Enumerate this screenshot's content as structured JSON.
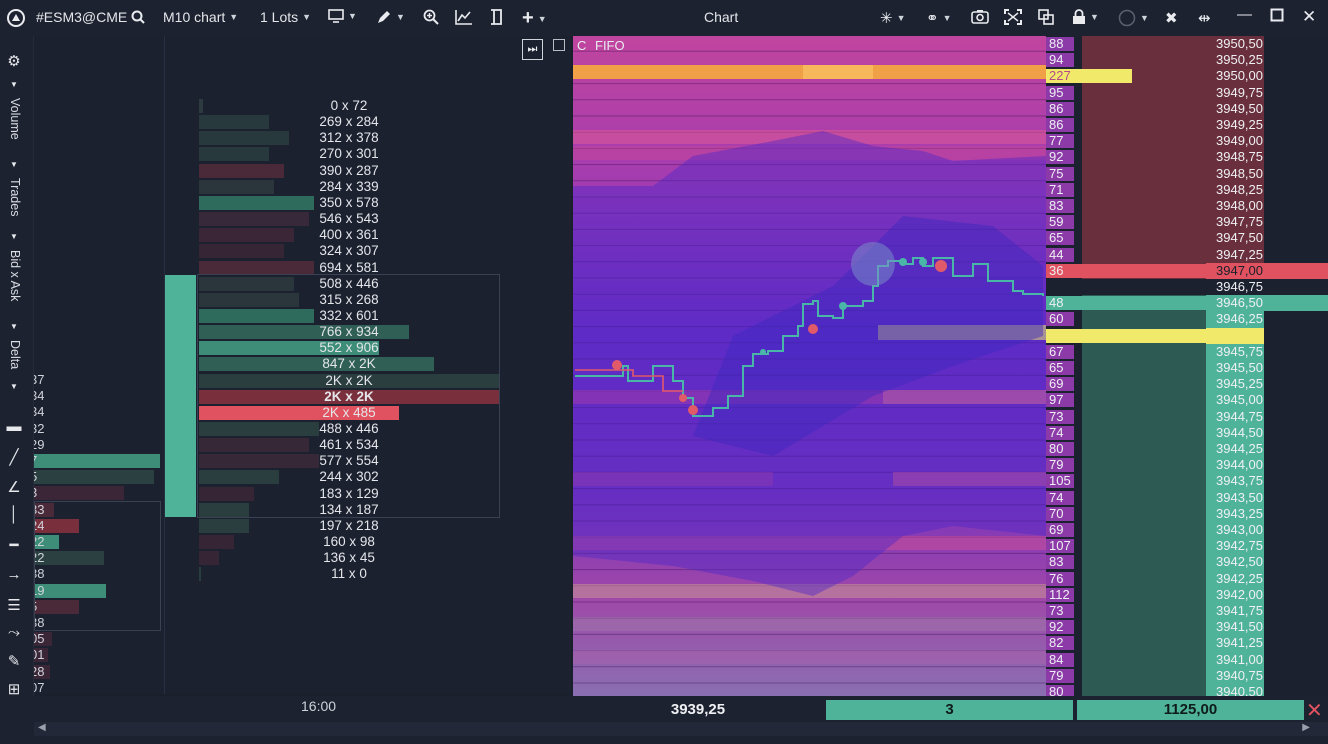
{
  "toolbar": {
    "symbol": "#ESM3@CME",
    "timeframe": "M10 chart",
    "lots": "1 Lots",
    "window_title": "Chart"
  },
  "side_tabs": [
    "Volume",
    "Trades",
    "Bid x Ask",
    "Delta"
  ],
  "volume_profile": {
    "rows": [
      "0 x 72",
      "269 x 284",
      "312 x 378",
      "270 x 301",
      "390 x 287",
      "284 x 339",
      "350 x 578",
      "546 x 543",
      "400 x 361",
      "324 x 307",
      "694 x 581",
      "508 x 446",
      "315 x 268",
      "332 x 601",
      "766 x 934",
      "552 x 906",
      "847 x 2K",
      "2K x 2K",
      "2K x 2K",
      "2K x 485",
      "488 x 446",
      "461 x 534",
      "577 x 554",
      "244 x 302",
      "183 x 129",
      "134 x 187",
      "197 x 218",
      "160 x 98",
      "136 x 45",
      "11 x 0"
    ],
    "time_label": "16:00",
    "left_clipped_numbers": [
      "37",
      "34",
      "34",
      "32",
      "29",
      "7",
      "5",
      "3",
      "33",
      "24",
      "22",
      "22",
      "38",
      "19",
      "5",
      "38",
      "05",
      "01",
      "28",
      "07"
    ]
  },
  "chart": {
    "mode_letter": "C",
    "mode_label": "FIFO",
    "current_price": "3939,25"
  },
  "dom": {
    "rows": [
      {
        "vol": "88",
        "price": "3950,50"
      },
      {
        "vol": "94",
        "price": "3950,25"
      },
      {
        "vol": "227",
        "price": "3950,00"
      },
      {
        "vol": "95",
        "price": "3949,75"
      },
      {
        "vol": "86",
        "price": "3949,50"
      },
      {
        "vol": "86",
        "price": "3949,25"
      },
      {
        "vol": "77",
        "price": "3949,00"
      },
      {
        "vol": "92",
        "price": "3948,75"
      },
      {
        "vol": "75",
        "price": "3948,50"
      },
      {
        "vol": "71",
        "price": "3948,25"
      },
      {
        "vol": "83",
        "price": "3948,00"
      },
      {
        "vol": "59",
        "price": "3947,75"
      },
      {
        "vol": "65",
        "price": "3947,50"
      },
      {
        "vol": "44",
        "price": "3947,25"
      },
      {
        "vol": "36",
        "price": "3947,00"
      },
      {
        "vol": "",
        "price": "3946,75"
      },
      {
        "vol": "48",
        "price": "3946,50"
      },
      {
        "vol": "60",
        "price": "3946,25"
      },
      {
        "vol": "",
        "price": "3946,00"
      },
      {
        "vol": "67",
        "price": "3945,75"
      },
      {
        "vol": "65",
        "price": "3945,50"
      },
      {
        "vol": "69",
        "price": "3945,25"
      },
      {
        "vol": "97",
        "price": "3945,00"
      },
      {
        "vol": "73",
        "price": "3944,75"
      },
      {
        "vol": "74",
        "price": "3944,50"
      },
      {
        "vol": "80",
        "price": "3944,25"
      },
      {
        "vol": "79",
        "price": "3944,00"
      },
      {
        "vol": "105",
        "price": "3943,75"
      },
      {
        "vol": "74",
        "price": "3943,50"
      },
      {
        "vol": "70",
        "price": "3943,25"
      },
      {
        "vol": "69",
        "price": "3943,00"
      },
      {
        "vol": "107",
        "price": "3942,75"
      },
      {
        "vol": "83",
        "price": "3942,50"
      },
      {
        "vol": "76",
        "price": "3942,25"
      },
      {
        "vol": "112",
        "price": "3942,00"
      },
      {
        "vol": "73",
        "price": "3941,75"
      },
      {
        "vol": "92",
        "price": "3941,50"
      },
      {
        "vol": "82",
        "price": "3941,25"
      },
      {
        "vol": "84",
        "price": "3941,00"
      },
      {
        "vol": "79",
        "price": "3940,75"
      },
      {
        "vol": "80",
        "price": "3940,50"
      }
    ],
    "order_marker": "1",
    "quantity": "3",
    "price_field": "1125,00"
  },
  "colors": {
    "ask": "#e0525f",
    "bid": "#4fb39a",
    "highlight": "#f1e96a",
    "bg": "#1c2130"
  }
}
